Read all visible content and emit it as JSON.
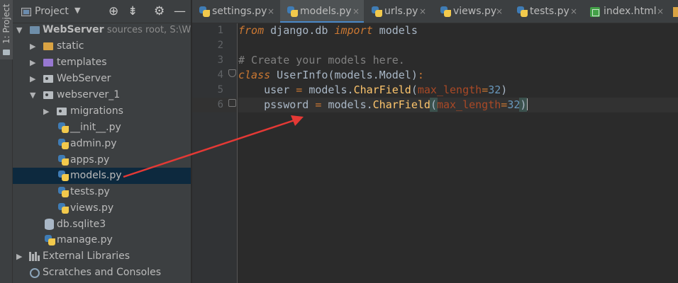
{
  "sidebar_strip": {
    "label": "1: Project"
  },
  "project_panel": {
    "title": "Project",
    "tools": [
      "target-icon",
      "collapse-icon",
      "gear-icon",
      "minimize-icon"
    ],
    "tree": [
      {
        "label": "WebServer",
        "sub": "sources root,  S:\\Web",
        "icon": "folder-icon",
        "expanded": true
      },
      {
        "label": "static",
        "icon": "folder-icon"
      },
      {
        "label": "templates",
        "icon": "folder-icon"
      },
      {
        "label": "WebServer",
        "icon": "package-icon"
      },
      {
        "label": "webserver_1",
        "icon": "package-icon",
        "expanded": true
      },
      {
        "label": "migrations",
        "icon": "package-icon"
      },
      {
        "label": "__init__.py",
        "icon": "python-file-icon"
      },
      {
        "label": "admin.py",
        "icon": "python-file-icon"
      },
      {
        "label": "apps.py",
        "icon": "python-file-icon"
      },
      {
        "label": "models.py",
        "icon": "python-file-icon",
        "selected": true
      },
      {
        "label": "tests.py",
        "icon": "python-file-icon"
      },
      {
        "label": "views.py",
        "icon": "python-file-icon"
      },
      {
        "label": "db.sqlite3",
        "icon": "database-icon"
      },
      {
        "label": "manage.py",
        "icon": "python-file-icon"
      },
      {
        "label": "External Libraries",
        "icon": "library-icon"
      },
      {
        "label": "Scratches and Consoles",
        "icon": "scratch-icon"
      }
    ]
  },
  "tabs": [
    {
      "label": "settings.py",
      "icon": "python-file-icon"
    },
    {
      "label": "models.py",
      "icon": "python-file-icon",
      "active": true
    },
    {
      "label": "urls.py",
      "icon": "python-file-icon"
    },
    {
      "label": "views.py",
      "icon": "python-file-icon"
    },
    {
      "label": "tests.py",
      "icon": "python-file-icon"
    },
    {
      "label": "index.html",
      "icon": "html-file-icon"
    }
  ],
  "close_glyph": "×",
  "editor": {
    "line_numbers": [
      "1",
      "2",
      "3",
      "4",
      "5",
      "6"
    ],
    "lines": {
      "l1": {
        "kw_from": "from",
        "mod": " django.db ",
        "kw_import": "import",
        "name": " models"
      },
      "l3": {
        "comment": "# Create your models here."
      },
      "l4": {
        "kw_class": "class",
        "cls": " UserInfo",
        "paren_open": "(",
        "base": "models.Model",
        "paren_close": ")",
        "colon": ":"
      },
      "l5": {
        "indent": "    ",
        "var": "user",
        "eq": " = ",
        "obj": "models.",
        "fn": "CharField",
        "open": "(",
        "param": "max_length",
        "assign": "=",
        "num": "32",
        "close": ")"
      },
      "l6": {
        "indent": "    ",
        "var": "pssword",
        "eq": " = ",
        "obj": "models.",
        "fn": "CharField",
        "open": "(",
        "param": "max_length",
        "assign": "=",
        "num": "32",
        "close": ")"
      }
    }
  },
  "colors": {
    "background": "#2b2b2b",
    "panel": "#3c3f41",
    "selection": "#0d293e",
    "keyword": "#cc7832",
    "function": "#ffc66d",
    "param": "#aa4926",
    "number": "#6897bb",
    "comment": "#808080",
    "annotation_arrow": "#e53935"
  }
}
